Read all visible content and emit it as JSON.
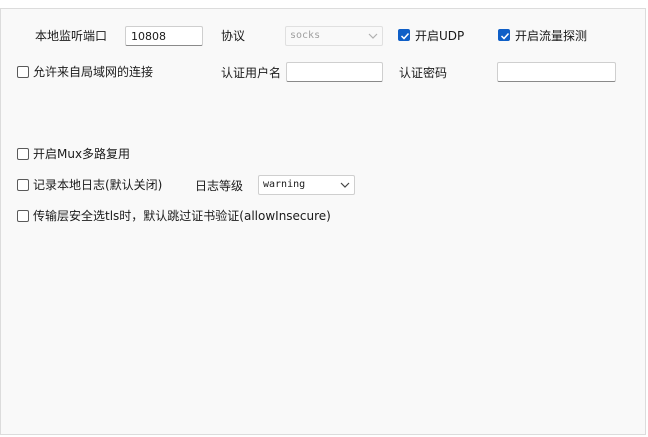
{
  "local_port": {
    "label": "本地监听端口",
    "value": "10808"
  },
  "protocol": {
    "label": "协议",
    "selected": "socks"
  },
  "enable_udp": {
    "label": "开启UDP",
    "checked": true
  },
  "enable_sniffing": {
    "label": "开启流量探测",
    "checked": true
  },
  "allow_lan": {
    "label": "允许来自局域网的连接",
    "checked": false
  },
  "auth_username": {
    "label": "认证用户名",
    "value": ""
  },
  "auth_password": {
    "label": "认证密码",
    "value": ""
  },
  "enable_mux": {
    "label": "开启Mux多路复用",
    "checked": false
  },
  "log_local": {
    "label": "记录本地日志(默认关闭)",
    "checked": false
  },
  "log_level": {
    "label": "日志等级",
    "selected": "warning"
  },
  "allow_insecure": {
    "label": "传输层安全选tls时，默认跳过证书验证(allowInsecure)",
    "checked": false
  },
  "colors": {
    "accent": "#0f5fc7",
    "panel_bg": "#f9f9f9"
  }
}
